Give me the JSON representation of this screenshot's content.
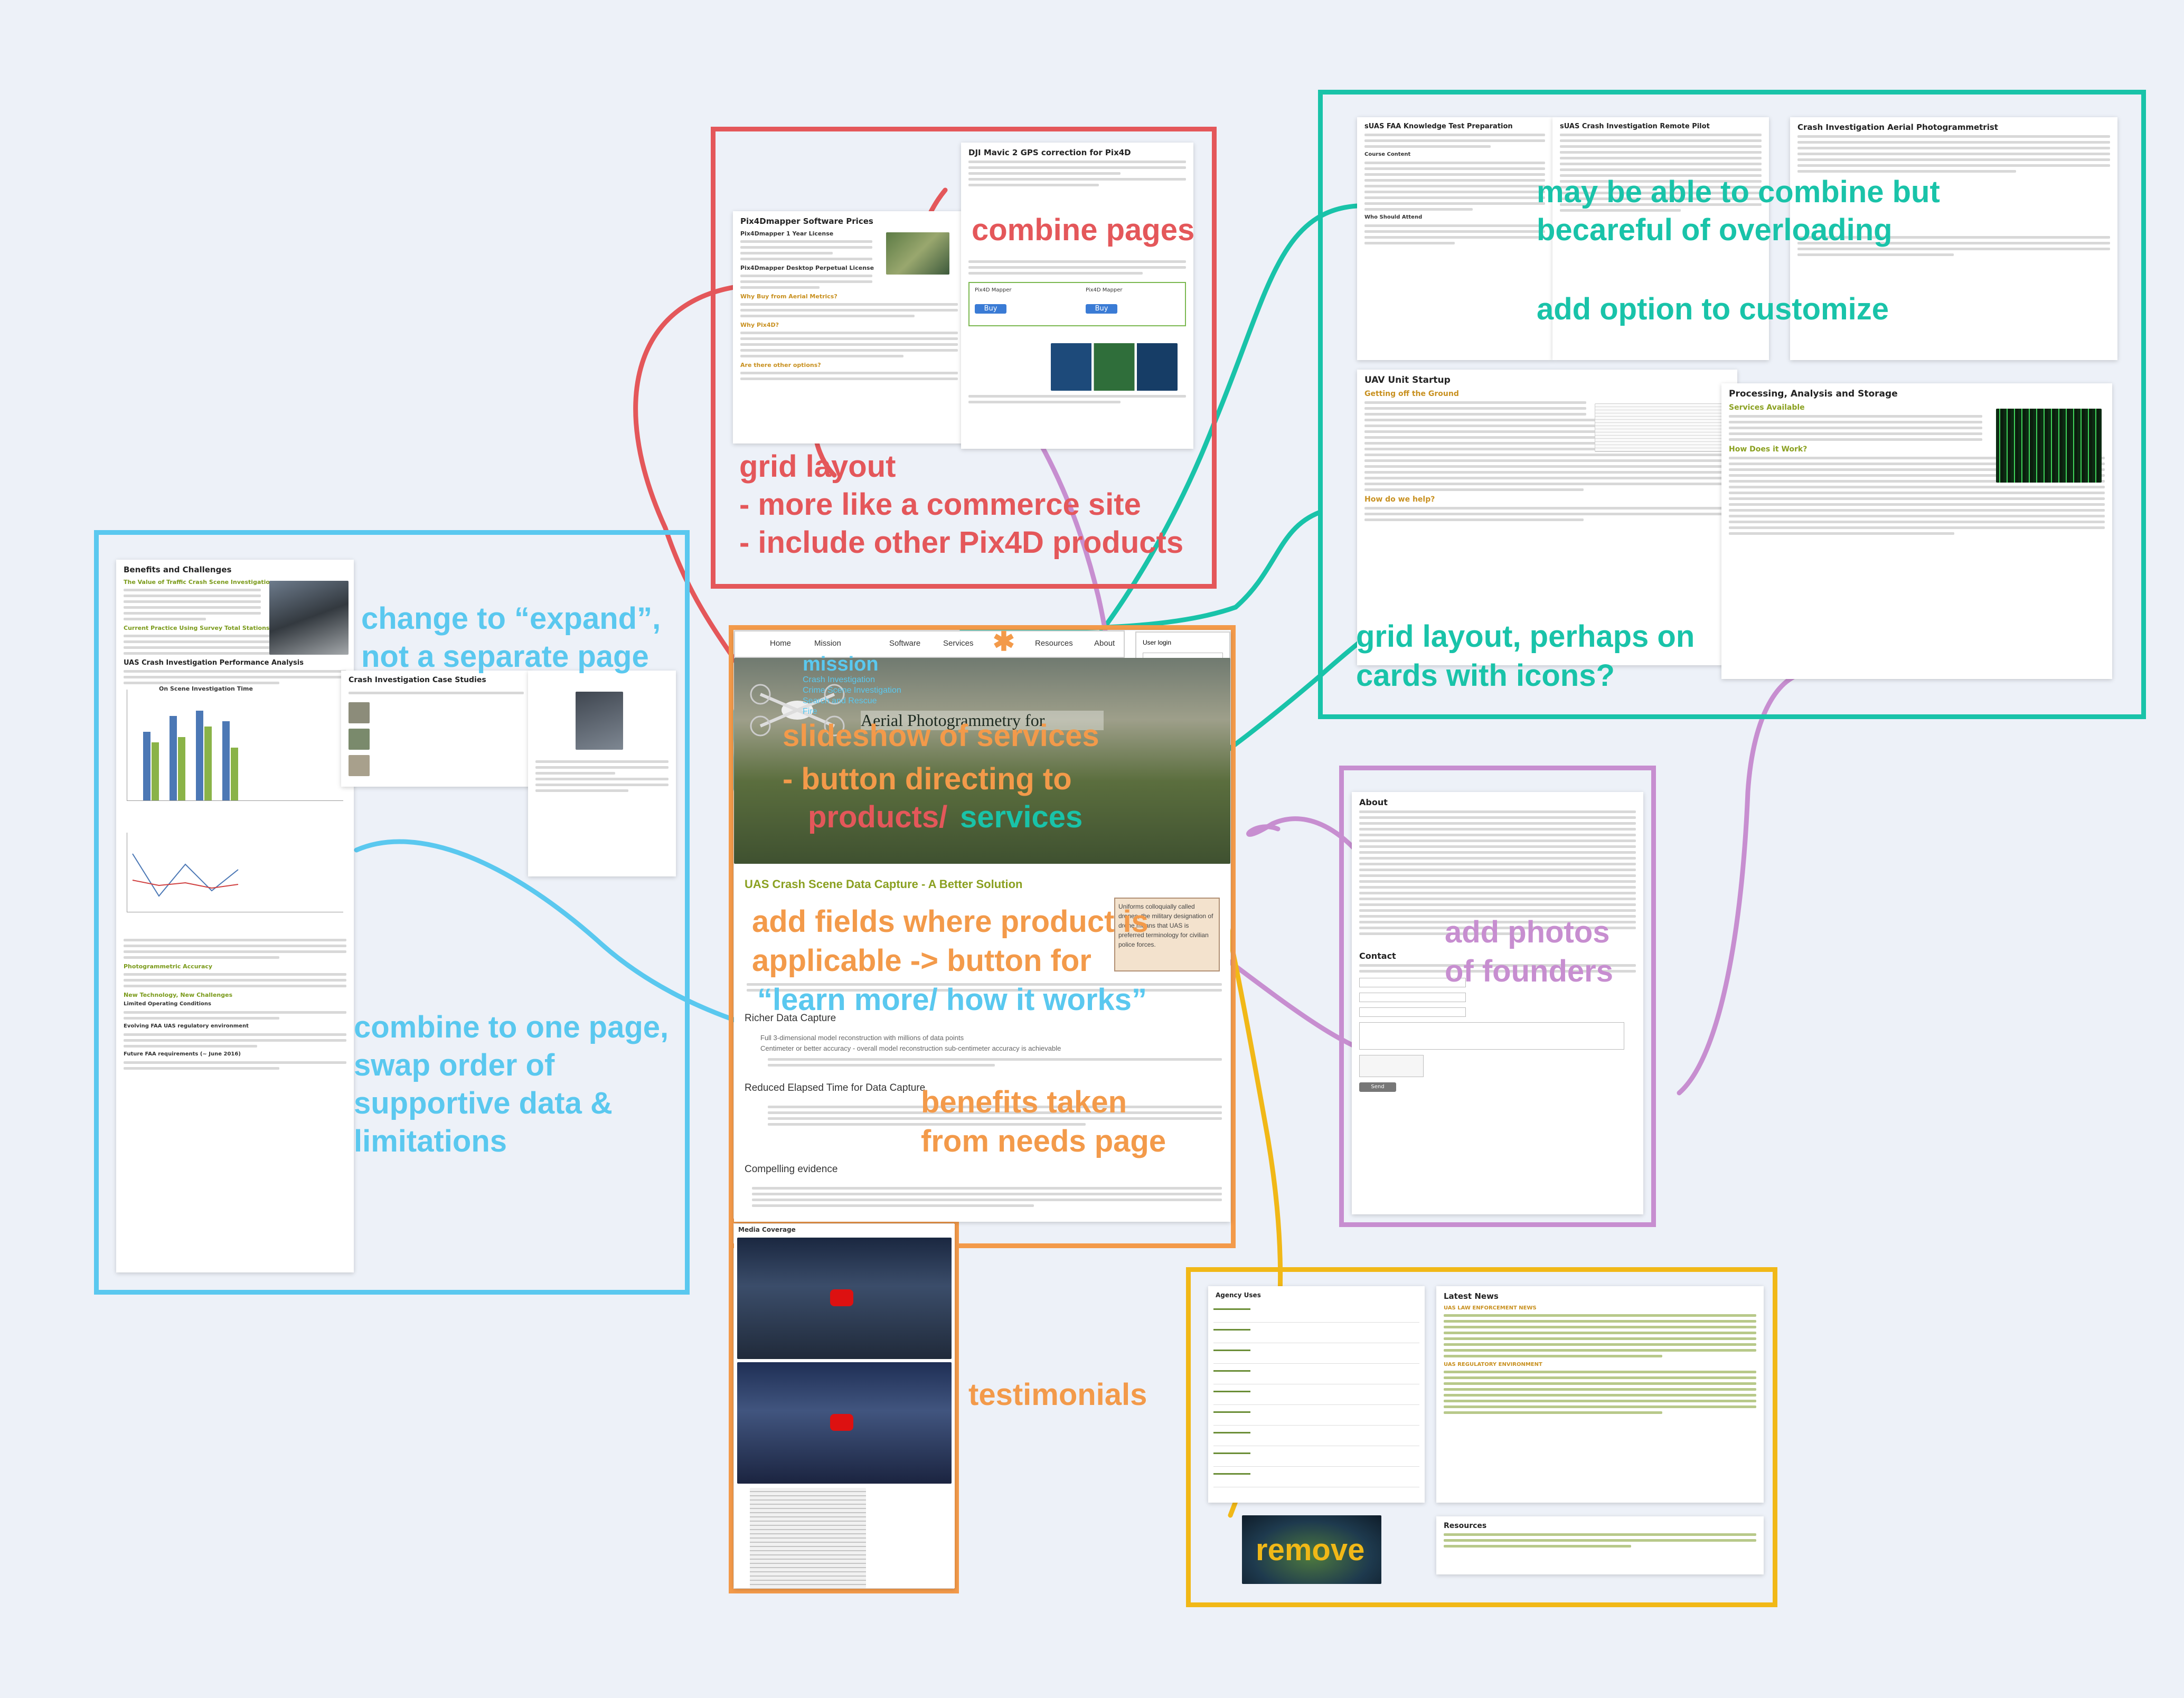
{
  "colors": {
    "background": "#edf1f8",
    "red": "#e4575a",
    "blue": "#5ac8ef",
    "teal": "#19c3a9",
    "orange": "#f39a4a",
    "purple": "#c78ed0",
    "gold": "#f1b817"
  },
  "notes": {
    "combine_pages": "combine pages",
    "grid_layout": "grid layout",
    "grid_commerce": "- more like a commerce site",
    "grid_include": "- include other Pix4D products",
    "expand_1": "change to “expand”,",
    "expand_2": "not a separate page",
    "combine_one_1": "combine to one page,",
    "combine_one_2": "swap order of",
    "combine_one_3": "supportive data &",
    "combine_one_4": "limitations",
    "mission": "mission",
    "slideshow_1": "slideshow of services",
    "slideshow_2": "- button directing to",
    "slideshow_3a": "products/ ",
    "slideshow_3b": "services",
    "fields_1": "add fields where product is",
    "fields_2": "applicable -> button for",
    "fields_3": "“learn more/ how it works”",
    "benefits_1": "benefits taken",
    "benefits_2": "from needs page",
    "testimonials": "testimonials",
    "overload_1": "may be able to combine but",
    "overload_2": "becareful of overloading",
    "customize": "add option to customize",
    "cards_1": "grid layout, perhaps on",
    "cards_2": "cards with icons?",
    "founders_1": "add photos",
    "founders_2": "of founders",
    "remove": "remove"
  },
  "pix4d": {
    "prices_title": "Pix4Dmapper Software Prices",
    "license_head": "Pix4Dmapper 1 Year License",
    "desktop_head": "Pix4Dmapper Desktop Perpetual License",
    "why_buy": "Why Buy from Aerial Metrics?",
    "why_pix4d": "Why Pix4D?",
    "other_options": "Are there other options?",
    "correction_title": "DJI Mavic 2 GPS correction for Pix4D",
    "product_name": "Pix4D Mapper",
    "buy": "Buy"
  },
  "uas": {
    "faa_title": "sUAS FAA Knowledge Test Preparation",
    "faa_course": "Course Content",
    "faa_who": "Who Should Attend",
    "remote_title": "sUAS Crash Investigation Remote Pilot",
    "photo_title": "Crash Investigation Aerial Photogrammetrist",
    "startup_title": "UAV Unit Startup",
    "startup_sub": "Getting off the Ground",
    "startup_help": "How do we help?",
    "processing_title": "Processing, Analysis and Storage",
    "services_available": "Services Available",
    "how_work": "How Does it Work?"
  },
  "home": {
    "nav": [
      "Home",
      "Mission",
      "Software",
      "Services",
      "Resources",
      "About"
    ],
    "login": "User login",
    "mission_link": "mission",
    "dropdown": [
      "Crash Investigation",
      "Crime Scene Investigation",
      "Search and Rescue",
      "Fire"
    ],
    "hero_title": "Aerial Photogrammetry for",
    "section_title": "UAS Crash Scene Data Capture - A Better Solution",
    "callout": "Uniforms colloquially called drones, the military designation of drone means that UAS is preferred terminology for civilian police forces.",
    "richer": "Richer Data Capture",
    "bullet_1": "Full 3-dimensional model reconstruction with millions of data points",
    "bullet_2": "Centimeter or better accuracy - overall model reconstruction sub-centimeter accuracy is achievable",
    "reduced": "Reduced Elapsed Time for Data Capture",
    "compelling": "Compelling evidence",
    "media": "Media Coverage"
  },
  "benefits": {
    "title": "Benefits and Challenges",
    "value": "The Value of Traffic Crash Scene Investigation",
    "current": "Current Practice Using Survey Total Stations",
    "perf": "UAS Crash Investigation Performance Analysis",
    "scene_time": "On Scene Investigation Time",
    "case_studies": "Crash Investigation Case Studies",
    "photo_accuracy": "Photogrammetric Accuracy",
    "new_tech": "New Technology, New Challenges",
    "limited": "Limited Operating Conditions",
    "evolving": "Evolving FAA UAS regulatory environment",
    "future": "Future FAA requirements (~ June 2016)"
  },
  "about": {
    "title": "About",
    "contact": "Contact",
    "send": "Send message"
  },
  "resources": {
    "agency": "Agency Uses",
    "latest": "Latest News",
    "law": "UAS LAW ENFORCEMENT NEWS",
    "regulatory": "UAS REGULATORY ENVIRONMENT",
    "resources": "Resources"
  }
}
